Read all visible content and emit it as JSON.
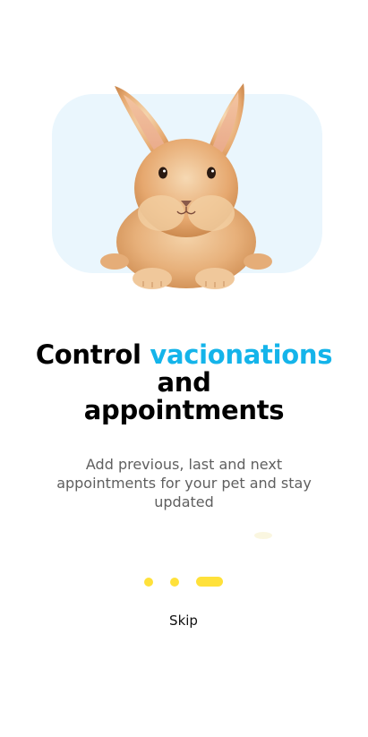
{
  "onboarding": {
    "title_prefix": "Control",
    "title_highlight": "vacionations",
    "title_line2": "and",
    "title_line3": "appointments",
    "description": "Add previous, last and next appointments for your pet and stay updated",
    "skip_label": "Skip",
    "page_indicator": {
      "current_page": 3,
      "total_pages": 3
    }
  },
  "colors": {
    "accent": "#14b4ea",
    "indicator": "#ffe13a",
    "hero_background": "#eaf6fd",
    "title": "#000000",
    "description": "#5f5f5f"
  },
  "images": {
    "hero": "rabbit-illustration"
  }
}
